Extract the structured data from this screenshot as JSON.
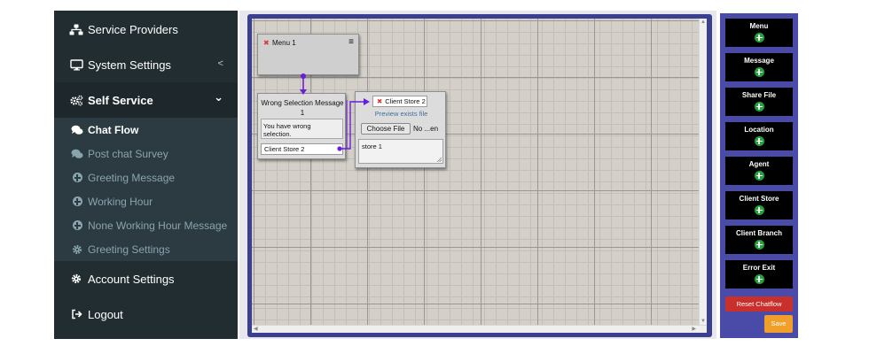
{
  "sidebar": {
    "items": [
      {
        "label": "Service Providers",
        "icon": "sitemap-icon"
      },
      {
        "label": "System Settings",
        "icon": "desktop-icon",
        "chevron": "<"
      },
      {
        "label": "Self Service",
        "icon": "cogs-icon",
        "chevron": "⌄"
      },
      {
        "label": "Account Settings",
        "icon": "gear-icon"
      },
      {
        "label": "Logout",
        "icon": "sign-out-icon"
      }
    ],
    "submenu": [
      {
        "label": "Chat Flow",
        "icon": "comments-icon",
        "active": true
      },
      {
        "label": "Post chat Survey",
        "icon": "comments-icon"
      },
      {
        "label": "Greeting Message",
        "icon": "plus-circle-icon"
      },
      {
        "label": "Working Hour",
        "icon": "plus-circle-icon"
      },
      {
        "label": "None Working Hour Message",
        "icon": "plus-circle-icon"
      },
      {
        "label": "Greeting Settings",
        "icon": "gear-icon"
      }
    ]
  },
  "canvas": {
    "menu_node": {
      "title": "Menu 1",
      "close": "✖",
      "menu_icon": "≡"
    },
    "wrong_node": {
      "title_line1": "Wrong Selection Message",
      "title_line2": "1",
      "message": "You have wrong selection.",
      "option": "Client Store 2"
    },
    "store_node": {
      "close": "✖",
      "title": "Client Store 2",
      "preview": "Preview exists file",
      "choose": "Choose File",
      "no_file": "No ...en",
      "text": "store 1"
    }
  },
  "toolbox": {
    "tools": [
      {
        "label": "Menu"
      },
      {
        "label": "Message"
      },
      {
        "label": "Share File"
      },
      {
        "label": "Location"
      },
      {
        "label": "Agent"
      },
      {
        "label": "Client Store"
      },
      {
        "label": "Client Branch"
      },
      {
        "label": "Error Exit"
      }
    ],
    "reset_label": "Reset Chatflow",
    "save_label": "Save"
  },
  "colors": {
    "sidebar": "#222d32",
    "submenu": "#2c3b41",
    "editor_frame": "#3b3f91",
    "toolbox": "#4a4aa8",
    "connector": "#6a1fd6",
    "reset": "#c9302c",
    "save": "#f0a02a",
    "add": "#21a53a"
  }
}
